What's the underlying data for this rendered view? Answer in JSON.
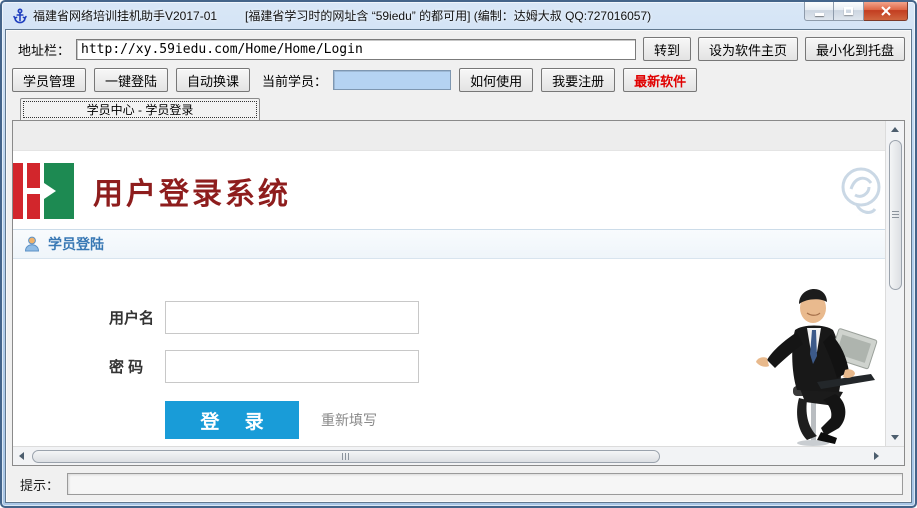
{
  "window": {
    "title": "福建省网络培训挂机助手V2017-01",
    "subtitle": "[福建省学习时的网址含 “59iedu” 的都可用] (编制：达姆大叔 QQ:727016057)",
    "controls": {
      "minimize": "minimize",
      "maximize": "maximize",
      "close": "close"
    }
  },
  "icons": {
    "app": "anchor-icon",
    "section": "user-icon",
    "watermark": "stamp-icon",
    "photo": "businessman-photo"
  },
  "address_bar": {
    "label": "地址栏：",
    "url": "http://xy.59iedu.com/Home/Home/Login",
    "go_button": "转到",
    "set_home_button": "设为软件主页",
    "tray_button": "最小化到托盘"
  },
  "toolbar": {
    "manage_button": "学员管理",
    "one_click_login_button": "一键登陆",
    "auto_switch_button": "自动换课",
    "current_student_label": "当前学员：",
    "current_student_value": "",
    "how_to_use_button": "如何使用",
    "register_button": "我要注册",
    "latest_software_button": "最新软件"
  },
  "tab": {
    "label": "学员中心 - 学员登录"
  },
  "page": {
    "header_title": "用户登录系统",
    "section_title": "学员登陆",
    "form": {
      "username_label": "用户名",
      "username_value": "",
      "password_label": "密 码",
      "password_value": "",
      "login_button": "登 录",
      "reset_link": "重新填写"
    }
  },
  "status_bar": {
    "label": "提示：",
    "value": ""
  },
  "colors": {
    "logo_red": "#d2262c",
    "logo_green": "#1d8a52",
    "title_red": "#8e1d1d",
    "section_blue": "#3878b4",
    "login_blue": "#199cd8",
    "latest_software_text": "#e00000",
    "current_student_bg": "#b5d3f2"
  }
}
